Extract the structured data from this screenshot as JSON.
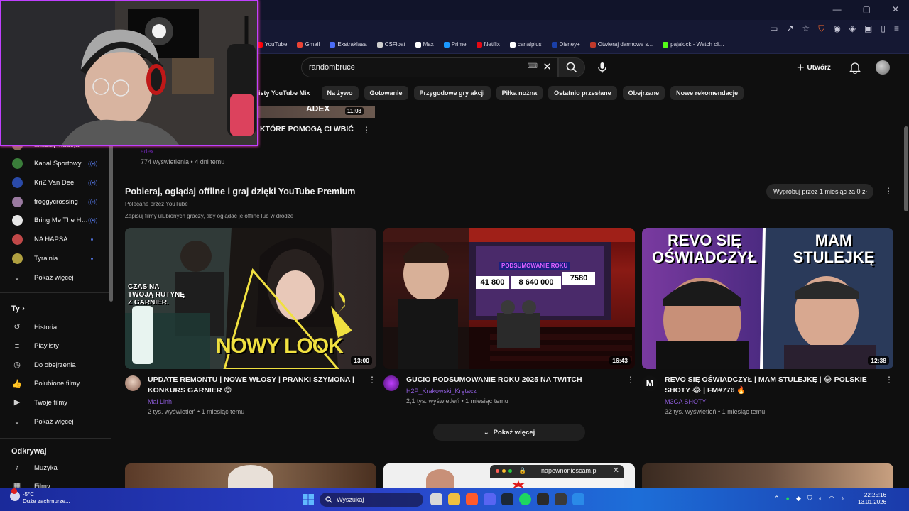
{
  "bookmarks": [
    {
      "label": "YouTube",
      "color": "#ff0000"
    },
    {
      "label": "Gmail",
      "color": "#ea4335"
    },
    {
      "label": "Ekstraklasa",
      "color": "#4a6cf7"
    },
    {
      "label": "CSFloat",
      "color": "#cfcfcf"
    },
    {
      "label": "Max",
      "color": "#ffffff"
    },
    {
      "label": "Prime",
      "color": "#1a98ff"
    },
    {
      "label": "Netflix",
      "color": "#e50914"
    },
    {
      "label": "canalplus",
      "color": "#ffffff"
    },
    {
      "label": "Disney+",
      "color": "#1a3fa8"
    },
    {
      "label": "Otwieraj darmowe s...",
      "color": "#c0392b"
    },
    {
      "label": "pajalock - Watch cli...",
      "color": "#53fc18"
    }
  ],
  "search": {
    "value": "randombruce"
  },
  "header": {
    "create_label": "Utwórz"
  },
  "chips": [
    "isty YouTube Mix",
    "Na żywo",
    "Gotowanie",
    "Przygodowe gry akcji",
    "Piłka nożna",
    "Ostatnio przesłane",
    "Obejrzane",
    "Nowe rekomendacje"
  ],
  "sidebar": {
    "subs": [
      {
        "label": "Mikołaj Madeja",
        "status": "none",
        "color": "#8a6d5a"
      },
      {
        "label": "Kanał Sportowy",
        "status": "live",
        "color": "#3a7d3a"
      },
      {
        "label": "KriZ Van Dee",
        "status": "live",
        "color": "#2a4aa8"
      },
      {
        "label": "froggycrossing",
        "status": "live",
        "color": "#9a7aa0"
      },
      {
        "label": "Bring Me The Ho...",
        "status": "live",
        "color": "#e6e6e6"
      },
      {
        "label": "NA HAPSA",
        "status": "dot",
        "color": "#c04848"
      },
      {
        "label": "Tyralnia",
        "status": "dot",
        "color": "#b0a040"
      }
    ],
    "show_more_1": "Pokaż więcej",
    "you_heading": "Ty",
    "you_items": [
      "Historia",
      "Playlisty",
      "Do obejrzenia",
      "Polubione filmy",
      "Twoje filmy",
      "Pokaż więcej"
    ],
    "explore_heading": "Odkrywaj",
    "explore_items": [
      "Muzyka",
      "Filmy"
    ]
  },
  "top_video": {
    "thumb_text": "ADEX",
    "duration": "11:08",
    "title": "KTÓRE POMOGĄ CI WBIĆ",
    "channel": "adex",
    "meta": "774 wyświetlenia • 4 dni temu"
  },
  "premium": {
    "title": "Pobieraj, oglądaj offline i graj dzięki YouTube Premium",
    "subtitle": "Polecane przez YouTube",
    "description": "Zapisuj filmy ulubionych graczy, aby oglądać je offline lub w drodze",
    "try_label": "Wypróbuj przez 1 miesiąc za 0 zł"
  },
  "videos": [
    {
      "title": "UPDATE REMONTU | NOWE WŁOSY | PRANKI SZYMONA | KONKURS GARNIER 😊",
      "channel": "Mai Linh",
      "meta": "2 tys. wyświetleń • 1 miesiąc temu",
      "duration": "13:00",
      "thumb_text_1": "CZAS NA TWOJĄ RUTYNĘ Z GARNIER.",
      "thumb_text_2": "NOWY LOOK",
      "avatar_color": "#c8a090"
    },
    {
      "title": "GUCIO PODSUMOWANIE ROKU 2025 NA TWITCH",
      "channel": "H2P_Krakowski_Krętacz",
      "meta": "2,1 tys. wyświetleń • 1 miesiąc temu",
      "duration": "16:43",
      "thumb_text_1": "PODSUMOWANIE ROKU",
      "stat_1": "41 800",
      "stat_2": "8 640 000",
      "stat_3": "7580",
      "avatar_color": "#8a2be2"
    },
    {
      "title": "REVO SIĘ OŚWIADCZYŁ | MAM STULEJKĘ | 😂 POLSKIE SHOTY 😂 | FM#776 🔥",
      "channel": "M3GA SHOTY",
      "meta": "32 tys. wyświetleń • 1 miesiąc temu",
      "duration": "12:38",
      "thumb_text_1": "REVO SIĘ OŚWIADCZYŁ",
      "thumb_text_2": "MAM STULEJKĘ",
      "avatar_color": "#1a1a1a"
    }
  ],
  "show_more_main": "Pokaż więcej",
  "popup": {
    "url": "napewnoniescam.pl"
  },
  "taskbar": {
    "temp": "-5°C",
    "weather": "Duże zachmurze...",
    "search": "Wyszukaj",
    "time": "22:25:16",
    "date": "13.01.2026"
  },
  "colors": {
    "accent_live": "#4f6fd6",
    "webcam_border": "#c040ff"
  }
}
